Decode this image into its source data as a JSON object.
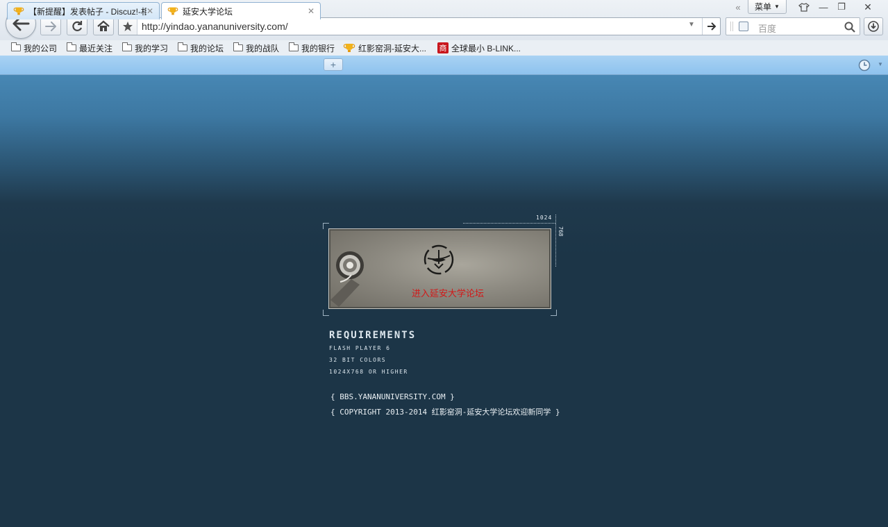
{
  "browser": {
    "url": "http://yindao.yananuniversity.com/",
    "search_placeholder": "百度",
    "menu_label": "菜单",
    "window_controls": [
      "«",
      "—",
      "❐",
      "✕"
    ],
    "bookmarks": [
      {
        "label": "我的公司",
        "icon": "folder-icon"
      },
      {
        "label": "最近关注",
        "icon": "folder-icon"
      },
      {
        "label": "我的学习",
        "icon": "folder-icon"
      },
      {
        "label": "我的论坛",
        "icon": "folder-icon"
      },
      {
        "label": "我的战队",
        "icon": "folder-icon"
      },
      {
        "label": "我的银行",
        "icon": "folder-icon"
      },
      {
        "label": "红影窑洞-延安大...",
        "icon": "trophy-icon"
      },
      {
        "label": "全球最小 B-LINK...",
        "icon": "shop-icon"
      }
    ],
    "tabs": [
      {
        "label": "【新提醒】发表帖子 - Discuz!-相",
        "active": false
      },
      {
        "label": "延安大学论坛",
        "active": true
      }
    ],
    "new_tab_label": "+"
  },
  "page": {
    "dimension_width": "1024",
    "dimension_height": "768",
    "enter_link": "进入延安大学论坛",
    "requirements_title": "REQUIREMENTS",
    "requirements": [
      "FLASH PLAYER 6",
      "32 BIT COLORS",
      "1024X768 OR HIGHER"
    ],
    "footer_site": "{ BBS.YANANUNIVERSITY.COM }",
    "footer_copyright": "{ COPYRIGHT 2013-2014 红影窑洞-延安大学论坛欢迎新同学 }"
  },
  "colors": {
    "page_background": "#1c3547",
    "link_red": "#d21818",
    "tab_bar": "#a9d2f3"
  }
}
